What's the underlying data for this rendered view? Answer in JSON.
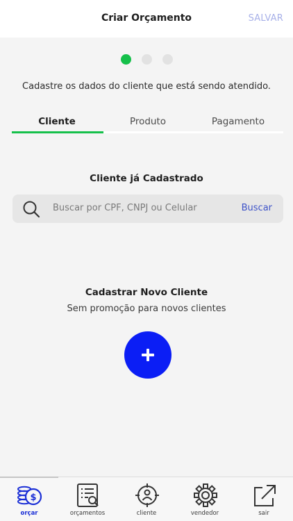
{
  "header": {
    "title": "Criar Orçamento",
    "save_label": "SALVAR"
  },
  "steps": {
    "total": 3,
    "current": 1
  },
  "instruction": "Cadastre os dados do cliente que está sendo atendido.",
  "tabs": [
    {
      "label": "Cliente",
      "active": true
    },
    {
      "label": "Produto",
      "active": false
    },
    {
      "label": "Pagamento",
      "active": false
    }
  ],
  "existing_client": {
    "title": "Cliente já Cadastrado",
    "search_placeholder": "Buscar por CPF, CNPJ ou Celular",
    "search_button": "Buscar"
  },
  "new_client": {
    "title": "Cadastrar Novo Cliente",
    "subtitle": "Sem promoção para novos clientes",
    "add_icon": "plus-icon"
  },
  "tabbar": {
    "items": [
      {
        "label": "orçar",
        "icon": "coins-dollar-icon",
        "active": true
      },
      {
        "label": "orçamentos",
        "icon": "document-search-icon",
        "active": false
      },
      {
        "label": "cliente",
        "icon": "user-target-icon",
        "active": false
      },
      {
        "label": "vendedor",
        "icon": "gear-icon",
        "active": false
      },
      {
        "label": "sair",
        "icon": "external-link-icon",
        "active": false
      }
    ]
  },
  "colors": {
    "accent_green": "#15c04a",
    "primary_blue": "#0b1ef5",
    "link_blue": "#3d52c8",
    "save_disabled": "#a7b0e8"
  }
}
